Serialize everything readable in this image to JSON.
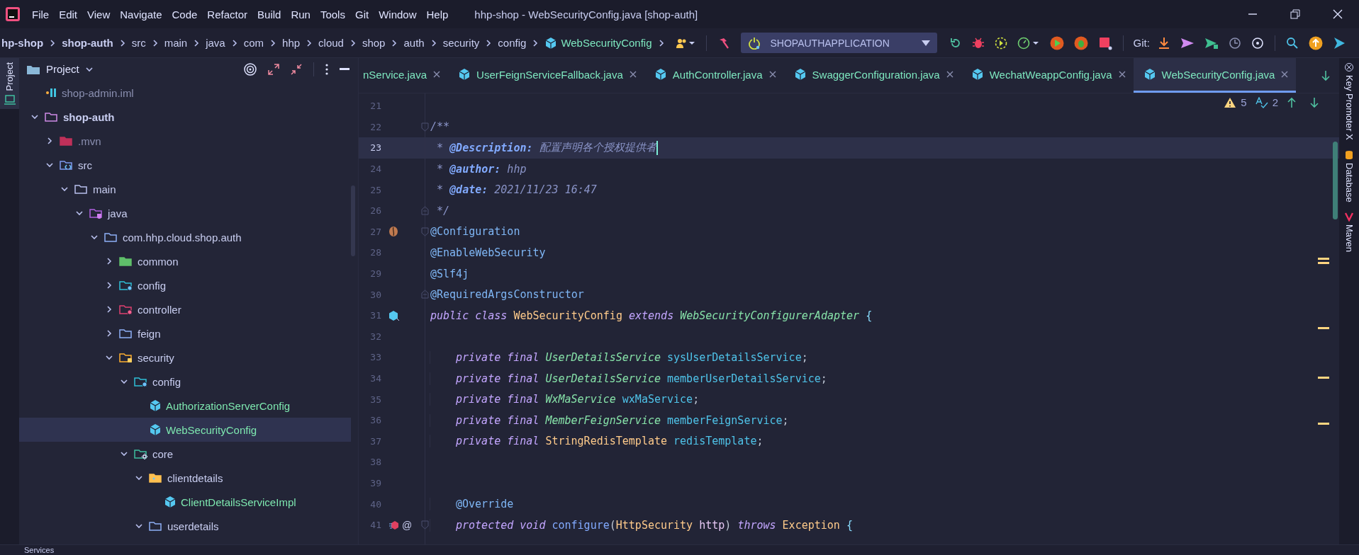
{
  "window": {
    "title": "hhp-shop - WebSecurityConfig.java [shop-auth]"
  },
  "menu": [
    "File",
    "Edit",
    "View",
    "Navigate",
    "Code",
    "Refactor",
    "Build",
    "Run",
    "Tools",
    "Git",
    "Window",
    "Help"
  ],
  "breadcrumbs": [
    {
      "label": "hp-shop",
      "kind": "module"
    },
    {
      "label": "shop-auth",
      "kind": "module"
    },
    {
      "label": "src",
      "kind": "folder"
    },
    {
      "label": "main",
      "kind": "folder"
    },
    {
      "label": "java",
      "kind": "folder"
    },
    {
      "label": "com",
      "kind": "folder"
    },
    {
      "label": "hhp",
      "kind": "folder"
    },
    {
      "label": "cloud",
      "kind": "folder"
    },
    {
      "label": "shop",
      "kind": "folder"
    },
    {
      "label": "auth",
      "kind": "folder"
    },
    {
      "label": "security",
      "kind": "folder"
    },
    {
      "label": "config",
      "kind": "folder"
    },
    {
      "label": "WebSecurityConfig",
      "kind": "class"
    }
  ],
  "run_config": "SHOPAUTHAPPLICATION",
  "git_label": "Git:",
  "left_strip": [
    {
      "label": "Project",
      "selected": true
    }
  ],
  "project_panel": {
    "title": "Project",
    "tree": [
      {
        "label": "shop-admin.iml",
        "kind": "module-file",
        "selected": false
      },
      {
        "label": "shop-auth",
        "kind": "module",
        "expanded": true,
        "selected": false,
        "children": [
          {
            "label": ".mvn",
            "kind": "excluded",
            "expanded": false,
            "selected": false
          },
          {
            "label": "src",
            "kind": "source",
            "expanded": true,
            "selected": false,
            "children": [
              {
                "label": "main",
                "kind": "folder",
                "expanded": true,
                "selected": false,
                "children": [
                  {
                    "label": "java",
                    "kind": "java",
                    "expanded": true,
                    "selected": false,
                    "children": [
                      {
                        "label": "com.hhp.cloud.shop.auth",
                        "kind": "package",
                        "expanded": true,
                        "selected": false,
                        "children": [
                          {
                            "label": "common",
                            "kind": "package-common",
                            "expanded": false,
                            "selected": false
                          },
                          {
                            "label": "config",
                            "kind": "package-config",
                            "expanded": false,
                            "selected": false
                          },
                          {
                            "label": "controller",
                            "kind": "package-controller",
                            "expanded": false,
                            "selected": false
                          },
                          {
                            "label": "feign",
                            "kind": "package",
                            "expanded": false,
                            "selected": false
                          },
                          {
                            "label": "security",
                            "kind": "package-security",
                            "expanded": true,
                            "selected": false,
                            "children": [
                              {
                                "label": "config",
                                "kind": "package-config",
                                "expanded": true,
                                "selected": false,
                                "children": [
                                  {
                                    "label": "AuthorizationServerConfig",
                                    "kind": "class",
                                    "selected": false
                                  },
                                  {
                                    "label": "WebSecurityConfig",
                                    "kind": "class",
                                    "selected": true
                                  }
                                ]
                              },
                              {
                                "label": "core",
                                "kind": "package-core",
                                "expanded": true,
                                "selected": false,
                                "children": [
                                  {
                                    "label": "clientdetails",
                                    "kind": "folder-yellow",
                                    "expanded": true,
                                    "selected": false,
                                    "children": [
                                      {
                                        "label": "ClientDetailsServiceImpl",
                                        "kind": "class",
                                        "selected": false
                                      }
                                    ]
                                  },
                                  {
                                    "label": "userdetails",
                                    "kind": "package",
                                    "expanded": true,
                                    "selected": false
                                  }
                                ]
                              }
                            ]
                          }
                        ]
                      }
                    ]
                  }
                ]
              }
            ]
          }
        ]
      }
    ]
  },
  "tabs": [
    {
      "label": "nService.java",
      "selected": false
    },
    {
      "label": "UserFeignServiceFallback.java",
      "selected": false
    },
    {
      "label": "AuthController.java",
      "selected": false
    },
    {
      "label": "SwaggerConfiguration.java",
      "selected": false
    },
    {
      "label": "WechatWeappConfig.java",
      "selected": false
    },
    {
      "label": "WebSecurityConfig.java",
      "selected": true
    }
  ],
  "inspections": {
    "warnings": "5",
    "typos": "2"
  },
  "code": {
    "lines": [
      {
        "number": "21",
        "current": false
      },
      {
        "number": "22",
        "current": false,
        "fold_marker": {
          "kind": "start"
        },
        "tokens": [
          {
            "text": "/**",
            "kind": "comment"
          }
        ]
      },
      {
        "number": "23",
        "current": true,
        "tokens": [
          {
            "text": " * ",
            "kind": "comment"
          },
          {
            "text": "@Description:",
            "kind": "doc-tag"
          },
          {
            "text": " 配置声明各个授权提供者",
            "kind": "comment"
          }
        ]
      },
      {
        "number": "24",
        "current": false,
        "tokens": [
          {
            "text": " * ",
            "kind": "comment"
          },
          {
            "text": "@author:",
            "kind": "doc-tag"
          },
          {
            "text": " hhp",
            "kind": "comment"
          }
        ]
      },
      {
        "number": "25",
        "current": false,
        "tokens": [
          {
            "text": " * ",
            "kind": "comment"
          },
          {
            "text": "@date:",
            "kind": "doc-tag"
          },
          {
            "text": " 2021/11/23 16:47",
            "kind": "comment"
          }
        ]
      },
      {
        "number": "26",
        "current": false,
        "fold_marker": {
          "kind": "end"
        },
        "tokens": [
          {
            "text": " */",
            "kind": "comment"
          }
        ]
      },
      {
        "number": "27",
        "current": false,
        "fold_marker": {
          "kind": "start"
        },
        "gutter_icon": {
          "kind": "bean"
        },
        "tokens": [
          {
            "text": "@Configuration",
            "kind": "annotation"
          }
        ]
      },
      {
        "number": "28",
        "current": false,
        "tokens": [
          {
            "text": "@EnableWebSecurity",
            "kind": "annotation"
          }
        ]
      },
      {
        "number": "29",
        "current": false,
        "tokens": [
          {
            "text": "@Slf4j",
            "kind": "annotation"
          }
        ]
      },
      {
        "number": "30",
        "current": false,
        "fold_marker": {
          "kind": "end"
        },
        "tokens": [
          {
            "text": "@RequiredArgsConstructor",
            "kind": "annotation"
          }
        ]
      },
      {
        "number": "31",
        "current": false,
        "gutter_icon": {
          "kind": "class"
        },
        "tokens": [
          {
            "text": "public ",
            "kind": "keyword"
          },
          {
            "text": "class ",
            "kind": "keyword"
          },
          {
            "text": "WebSecurityConfig ",
            "kind": "class"
          },
          {
            "text": "extends ",
            "kind": "keyword"
          },
          {
            "text": "WebSecurityConfigurerAdapter ",
            "kind": "interface"
          },
          {
            "text": "{",
            "kind": "brace"
          }
        ]
      },
      {
        "number": "32",
        "current": false
      },
      {
        "number": "33",
        "current": false,
        "indented": true,
        "tokens": [
          {
            "text": "private ",
            "kind": "keyword"
          },
          {
            "text": "final ",
            "kind": "keyword"
          },
          {
            "text": "UserDetailsService ",
            "kind": "interface"
          },
          {
            "text": "sysUserDetailsService",
            "kind": "field"
          },
          {
            "text": ";",
            "kind": "plain"
          }
        ]
      },
      {
        "number": "34",
        "current": false,
        "indented": true,
        "tokens": [
          {
            "text": "private ",
            "kind": "keyword"
          },
          {
            "text": "final ",
            "kind": "keyword"
          },
          {
            "text": "UserDetailsService ",
            "kind": "interface"
          },
          {
            "text": "memberUserDetailsService",
            "kind": "field"
          },
          {
            "text": ";",
            "kind": "plain"
          }
        ]
      },
      {
        "number": "35",
        "current": false,
        "indented": true,
        "tokens": [
          {
            "text": "private ",
            "kind": "keyword"
          },
          {
            "text": "final ",
            "kind": "keyword"
          },
          {
            "text": "WxMaService ",
            "kind": "interface"
          },
          {
            "text": "wxMaService",
            "kind": "field"
          },
          {
            "text": ";",
            "kind": "plain"
          }
        ]
      },
      {
        "number": "36",
        "current": false,
        "indented": true,
        "tokens": [
          {
            "text": "private ",
            "kind": "keyword"
          },
          {
            "text": "final ",
            "kind": "keyword"
          },
          {
            "text": "MemberFeignService ",
            "kind": "interface"
          },
          {
            "text": "memberFeignService",
            "kind": "field"
          },
          {
            "text": ";",
            "kind": "plain"
          }
        ]
      },
      {
        "number": "37",
        "current": false,
        "indented": true,
        "tokens": [
          {
            "text": "private ",
            "kind": "keyword"
          },
          {
            "text": "final ",
            "kind": "keyword"
          },
          {
            "text": "StringRedisTemplate ",
            "kind": "class"
          },
          {
            "text": "redisTemplate",
            "kind": "field"
          },
          {
            "text": ";",
            "kind": "plain"
          }
        ]
      },
      {
        "number": "38",
        "current": false
      },
      {
        "number": "39",
        "current": false
      },
      {
        "number": "40",
        "current": false,
        "indented": true,
        "tokens": [
          {
            "text": "@Override",
            "kind": "annotation"
          }
        ]
      },
      {
        "number": "41",
        "current": false,
        "indented": true,
        "fold_marker": {
          "kind": "start"
        },
        "gutter_icon": {
          "kind": "override"
        },
        "gutter_text": "@",
        "tokens": [
          {
            "text": "protected ",
            "kind": "keyword"
          },
          {
            "text": "void ",
            "kind": "keyword"
          },
          {
            "text": "configure",
            "kind": "method"
          },
          {
            "text": "(",
            "kind": "plain"
          },
          {
            "text": "HttpSecurity ",
            "kind": "class"
          },
          {
            "text": "http",
            "kind": "param"
          },
          {
            "text": ") ",
            "kind": "plain"
          },
          {
            "text": "throws ",
            "kind": "keyword"
          },
          {
            "text": "Exception ",
            "kind": "class"
          },
          {
            "text": "{",
            "kind": "brace"
          }
        ]
      }
    ]
  },
  "right_strip": [
    {
      "label": "Key Promoter X",
      "kind": "key"
    },
    {
      "label": "Database",
      "kind": "database"
    },
    {
      "label": "Maven",
      "kind": "maven"
    }
  ],
  "bottom_bar": {
    "tab": "Services"
  }
}
